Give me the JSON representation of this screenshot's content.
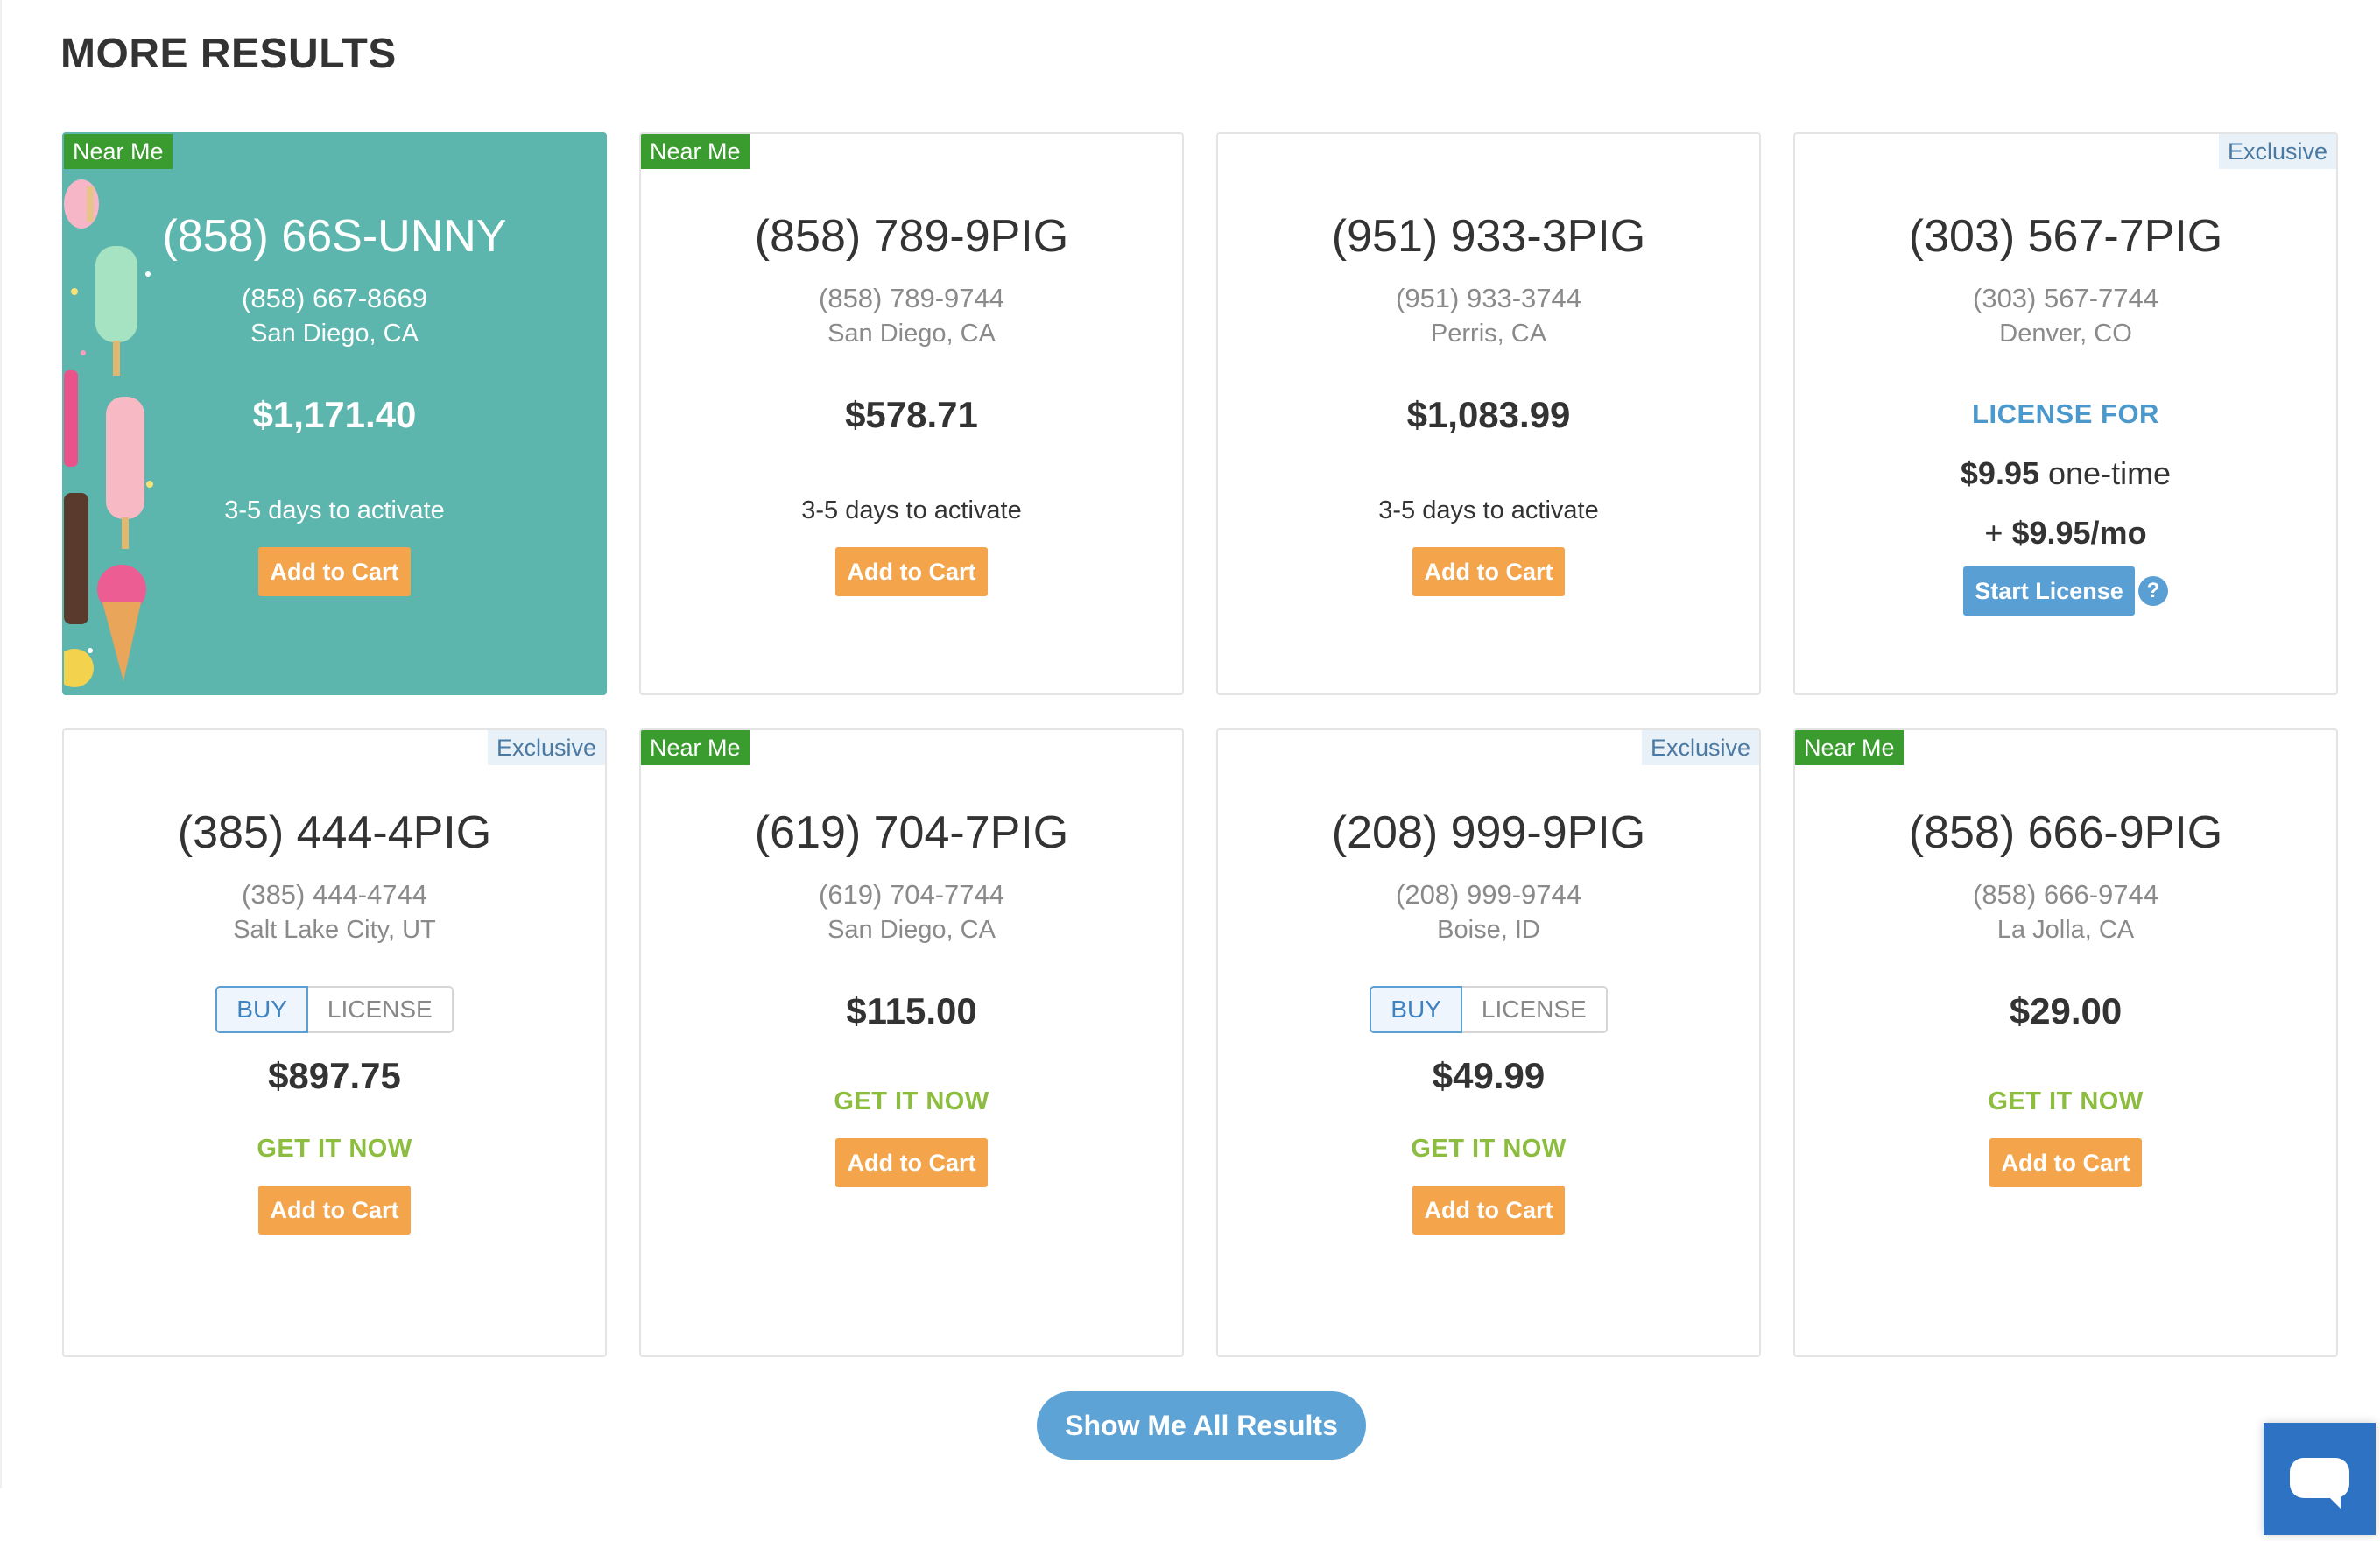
{
  "section": {
    "title": "MORE RESULTS"
  },
  "cards": [
    {
      "badge": "Near Me",
      "badge_type": "near",
      "featured": true,
      "phone": "(858) 66S-UNNY",
      "digits": "(858) 667-8669",
      "city": "San Diego, CA",
      "price": "$1,171.40",
      "activate": "3-5 days to activate",
      "cta": "Add to Cart",
      "decoration": "ice-cream-popsicles"
    },
    {
      "badge": "Near Me",
      "badge_type": "near",
      "phone": "(858) 789-9PIG",
      "digits": "(858) 789-9744",
      "city": "San Diego, CA",
      "price": "$578.71",
      "activate": "3-5 days to activate",
      "cta": "Add to Cart"
    },
    {
      "phone": "(951) 933-3PIG",
      "digits": "(951) 933-3744",
      "city": "Perris, CA",
      "price": "$1,083.99",
      "activate": "3-5 days to activate",
      "cta": "Add to Cart"
    },
    {
      "badge": "Exclusive",
      "badge_type": "exclusive",
      "phone": "(303) 567-7PIG",
      "digits": "(303) 567-7744",
      "city": "Denver, CO",
      "license_for": "LICENSE FOR",
      "license_price": "$9.95",
      "license_price_suffix": "one-time",
      "license_monthly_prefix": "+",
      "license_monthly": "$9.95/mo",
      "cta": "Start License",
      "help": "?"
    },
    {
      "badge": "Exclusive",
      "badge_type": "exclusive",
      "phone": "(385) 444-4PIG",
      "digits": "(385) 444-4744",
      "city": "Salt Lake City, UT",
      "toggle": {
        "buy": "BUY",
        "license": "LICENSE"
      },
      "price": "$897.75",
      "get_now": "GET IT NOW",
      "cta": "Add to Cart"
    },
    {
      "badge": "Near Me",
      "badge_type": "near",
      "phone": "(619) 704-7PIG",
      "digits": "(619) 704-7744",
      "city": "San Diego, CA",
      "price": "$115.00",
      "get_now": "GET IT NOW",
      "cta": "Add to Cart"
    },
    {
      "badge": "Exclusive",
      "badge_type": "exclusive",
      "phone": "(208) 999-9PIG",
      "digits": "(208) 999-9744",
      "city": "Boise, ID",
      "toggle": {
        "buy": "BUY",
        "license": "LICENSE"
      },
      "price": "$49.99",
      "get_now": "GET IT NOW",
      "cta": "Add to Cart"
    },
    {
      "badge": "Near Me",
      "badge_type": "near",
      "phone": "(858) 666-9PIG",
      "digits": "(858) 666-9744",
      "city": "La Jolla, CA",
      "price": "$29.00",
      "get_now": "GET IT NOW",
      "cta": "Add to Cart"
    }
  ],
  "show_all": {
    "label": "Show Me All Results"
  },
  "chat": {
    "icon": "chat-bubble-icon"
  },
  "colors": {
    "near_badge": "#3a9b2f",
    "exclusive_badge_bg": "#e8f1f8",
    "cart_button": "#f4a44a",
    "featured_bg": "#5db6ae",
    "get_now": "#8cbd3f",
    "license_blue": "#4a98cc"
  }
}
